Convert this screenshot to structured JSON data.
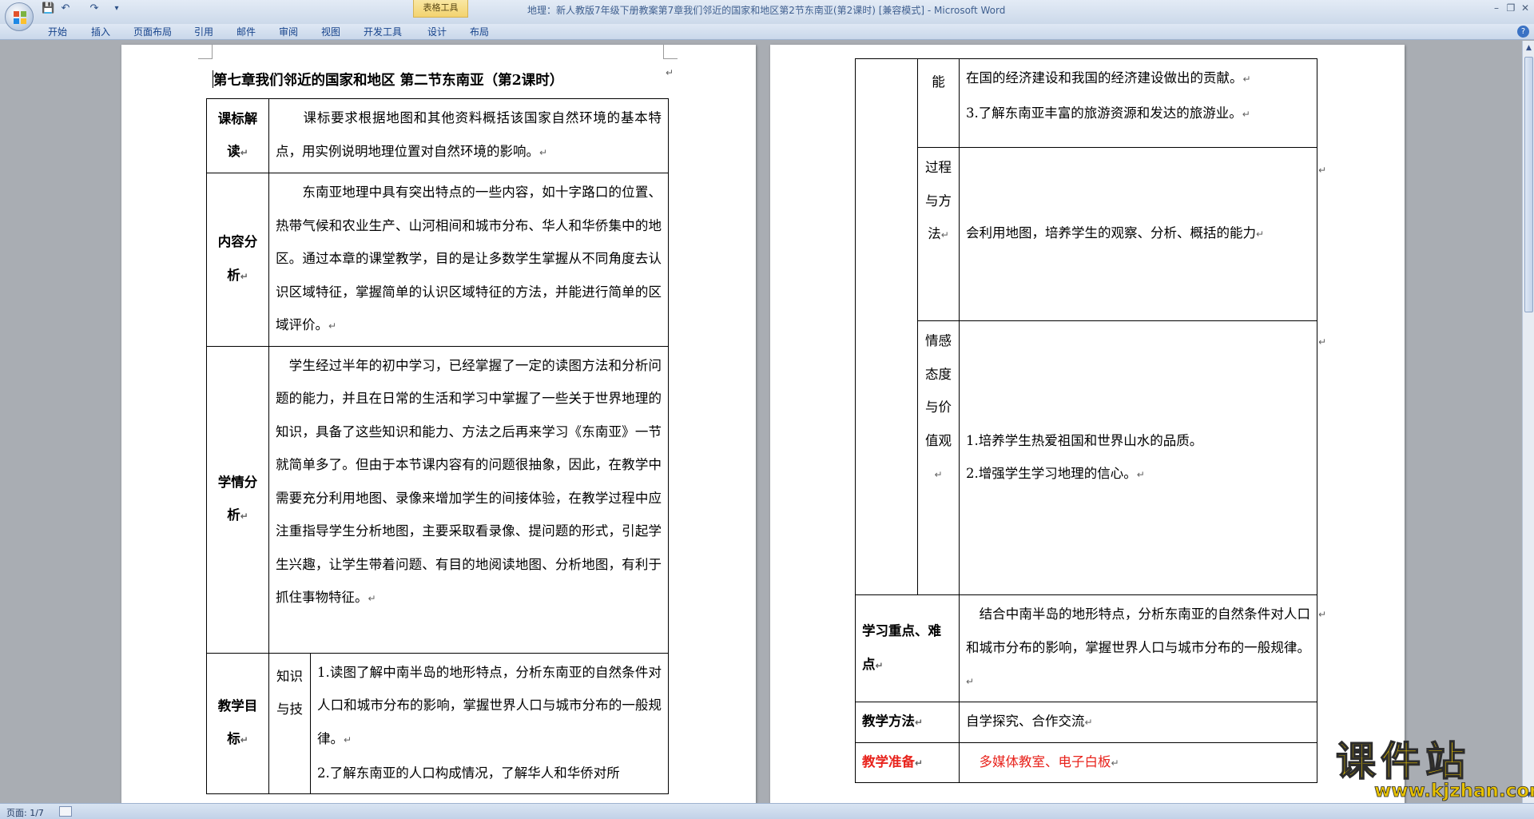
{
  "window": {
    "title": "地理：新人教版7年级下册教案第7章我们邻近的国家和地区第2节东南亚(第2课时) [兼容模式] - Microsoft Word",
    "context_tab": "表格工具",
    "controls": {
      "minimize": "–",
      "restore": "❐",
      "close": "✕"
    }
  },
  "quick_access": {
    "save_icon": "💾",
    "undo_icon": "↶",
    "redo_icon": "↷",
    "more_icon": "▾"
  },
  "ribbon": {
    "tabs": [
      "开始",
      "插入",
      "页面布局",
      "引用",
      "邮件",
      "审阅",
      "视图",
      "开发工具",
      "设计",
      "布局"
    ],
    "help": "?"
  },
  "document": {
    "heading": "第七章我们邻近的国家和地区 第二节东南亚（第2课时）",
    "page1": {
      "rows": [
        {
          "label": "课标解读",
          "text": "　　课标要求根据地图和其他资料概括该国家自然环境的基本特点，用实例说明地理位置对自然环境的影响。"
        },
        {
          "label": "内容分析",
          "text": "　　东南亚地理中具有突出特点的一些内容，如十字路口的位置、热带气候和农业生产、山河相间和城市分布、华人和华侨集中的地区。通过本章的课堂教学，目的是让多数学生掌握从不同角度去认识区域特征，掌握简单的认识区域特征的方法，并能进行简单的区域评价。"
        },
        {
          "label": "学情分析",
          "text": "　学生经过半年的初中学习，已经掌握了一定的读图方法和分析问题的能力，并且在日常的生活和学习中掌握了一些关于世界地理的知识，具备了这些知识和能力、方法之后再来学习《东南亚》一节就简单多了。但由于本节课内容有的问题很抽象，因此，在教学中需要充分利用地图、录像来增加学生的间接体验，在教学过程中应注重指导学生分析地图，主要采取看录像、提问题的形式，引起学生兴趣，让学生带着问题、有目的地阅读地图、分析地图，有利于抓住事物特征。"
        },
        {
          "label": "教学目标",
          "sub_label": "知识与技",
          "text_1": "1.读图了解中南半岛的地形特点，分析东南亚的自然条件对人口和城市分布的影响，掌握世界人口与城市分布的一般规律。",
          "text_2": "2.了解东南亚的人口构成情况，了解华人和华侨对所"
        }
      ]
    },
    "page2": {
      "rows": [
        {
          "sub_label": "能",
          "text_1": "在国的经济建设和我国的经济建设做出的贡献。",
          "text_2": "3.了解东南亚丰富的旅游资源和发达的旅游业。"
        },
        {
          "sub_label": "过程与方法",
          "text": "会利用地图，培养学生的观察、分析、概括的能力"
        },
        {
          "sub_label": "情感态度与价值观",
          "text_1": "1.培养学生热爱祖国和世界山水的品质。",
          "text_2": "2.增强学生学习地理的信心。"
        },
        {
          "label": "学习重点、难点",
          "text": "　结合中南半岛的地形特点，分析东南亚的自然条件对人口和城市分布的影响，掌握世界人口与城市分布的一般规律。"
        },
        {
          "label": "教学方法",
          "text": "自学探究、合作交流"
        },
        {
          "label": "教学准备",
          "text": "　多媒体教室、电子白板",
          "color": "#e8231c"
        }
      ]
    }
  },
  "status": {
    "page": "页面: 1/7"
  },
  "watermark": {
    "brand": "课件站",
    "url": "www.kjzhan.com"
  }
}
